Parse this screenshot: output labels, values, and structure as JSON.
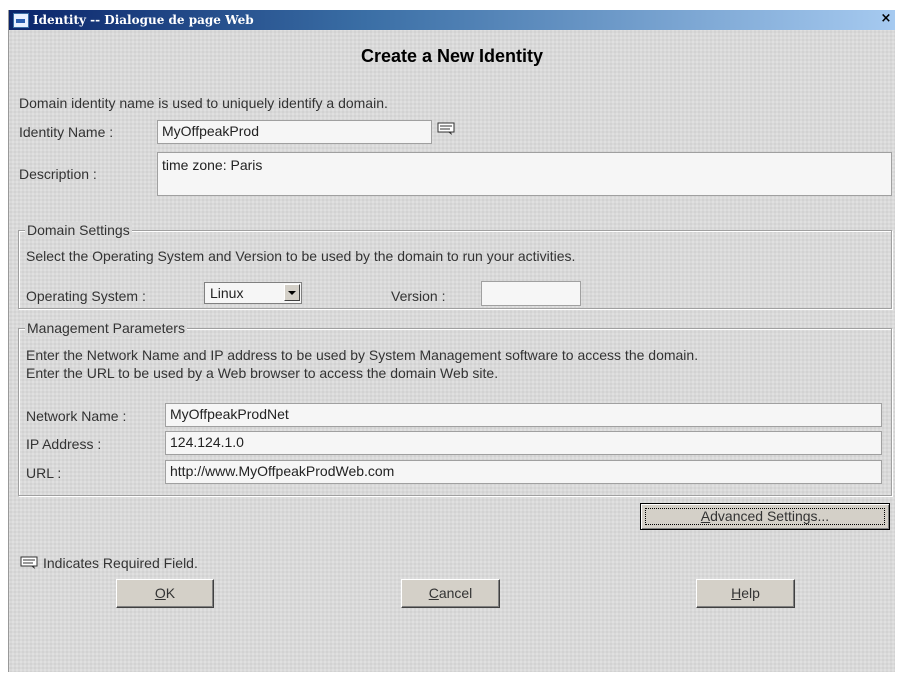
{
  "window": {
    "title": "Identity -- Dialogue de page Web",
    "close_glyph": "×"
  },
  "heading": "Create a New Identity",
  "intro": "Domain identity name is used to uniquely identify a domain.",
  "identity": {
    "name_label": "Identity Name :",
    "name_value": "MyOffpeakProd",
    "desc_label": "Description :",
    "desc_value": "time zone: Paris"
  },
  "domain_settings": {
    "legend": "Domain Settings",
    "hint": "Select the Operating System and Version to be used by the domain to run your activities.",
    "os_label": "Operating System :",
    "os_value": "Linux",
    "version_label": "Version :",
    "version_value": ""
  },
  "management": {
    "legend": "Management Parameters",
    "hint_line1": "Enter the Network Name and IP address to be used by System Management software to access the domain.",
    "hint_line2": "Enter the URL to be used by a Web browser to access the domain Web site.",
    "network_label": "Network Name :",
    "network_value": "MyOffpeakProdNet",
    "ip_label": "IP Address :",
    "ip_value": "124.124.1.0",
    "url_label": "URL :",
    "url_value": "http://www.MyOffpeakProdWeb.com"
  },
  "buttons": {
    "advanced_mnemonic": "A",
    "advanced_rest": "dvanced Settings...",
    "ok_mnemonic": "O",
    "ok_rest": "K",
    "cancel_mnemonic": "C",
    "cancel_rest": "ancel",
    "help_mnemonic": "H",
    "help_rest": "elp"
  },
  "required_note": "Indicates Required Field.",
  "icons": {
    "required": "required-field-icon",
    "window": "ie-window-icon",
    "close": "close-icon"
  },
  "colors": {
    "titlebar_start": "#0a246a",
    "titlebar_end": "#a6caf0",
    "dialog_bg": "#d9d9d9"
  }
}
